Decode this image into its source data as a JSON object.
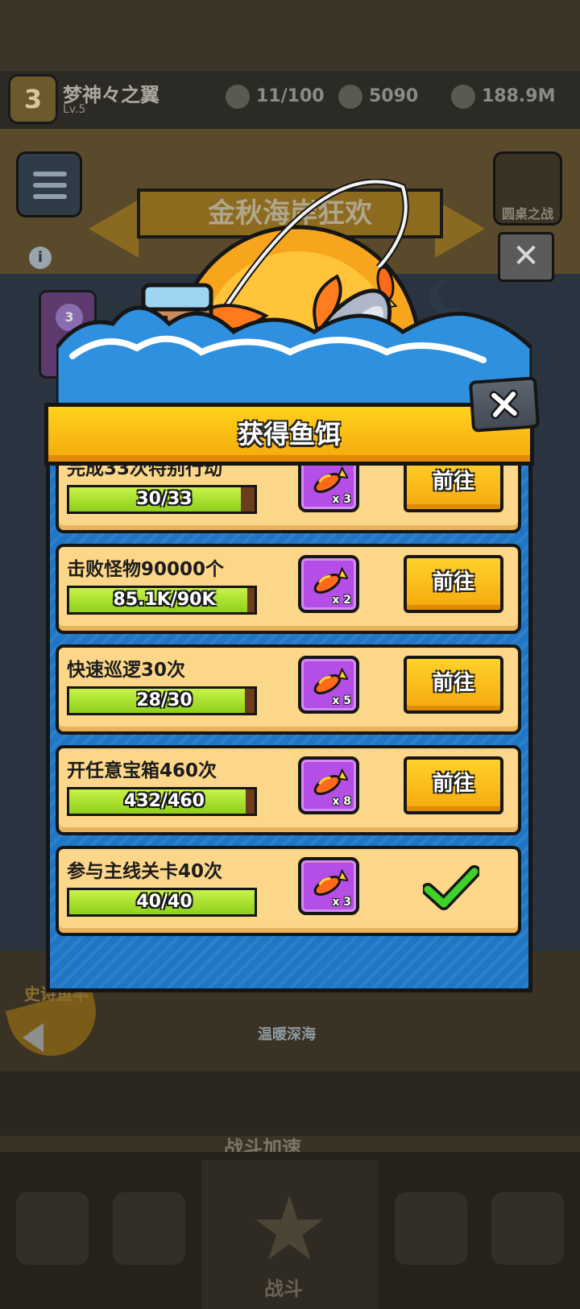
{
  "background": {
    "player": {
      "level": "3",
      "name": "梦神々之翼",
      "sub": "Lv.5"
    },
    "resources": [
      {
        "icon": "stamina-icon",
        "value": "11/100"
      },
      {
        "icon": "gem-icon",
        "value": "5090"
      },
      {
        "icon": "coin-icon",
        "value": "188.9M"
      }
    ],
    "event_banner": "金秋海岸狂欢",
    "shield_label": "圆桌之战",
    "sea_label": "温暖深海",
    "battle_boost": "战斗加速",
    "legend_label": "史诗鱼竿",
    "side_card_number": "3",
    "nav_center_label": "战斗"
  },
  "dialog": {
    "title": "获得鱼饵",
    "go_label": "前往",
    "tasks": [
      {
        "title": "完成33次特别行动",
        "progress_text": "30/33",
        "progress": 0.909,
        "reward_count": "x 3",
        "status": "go"
      },
      {
        "title": "击败怪物90000个",
        "progress_text": "85.1K/90K",
        "progress": 0.946,
        "reward_count": "x 2",
        "status": "go"
      },
      {
        "title": "快速巡逻30次",
        "progress_text": "28/30",
        "progress": 0.933,
        "reward_count": "x 5",
        "status": "go"
      },
      {
        "title": "开任意宝箱460次",
        "progress_text": "432/460",
        "progress": 0.939,
        "reward_count": "x 8",
        "status": "go"
      },
      {
        "title": "参与主线关卡40次",
        "progress_text": "40/40",
        "progress": 1.0,
        "reward_count": "x 3",
        "status": "done"
      }
    ]
  },
  "colors": {
    "card": "#fcd789",
    "frame": "#1e76c5",
    "reward": "#b54ee6",
    "bar_fill": "#8ed01a",
    "bar_empty": "#6b3d1c",
    "header": "#ffc21a"
  }
}
